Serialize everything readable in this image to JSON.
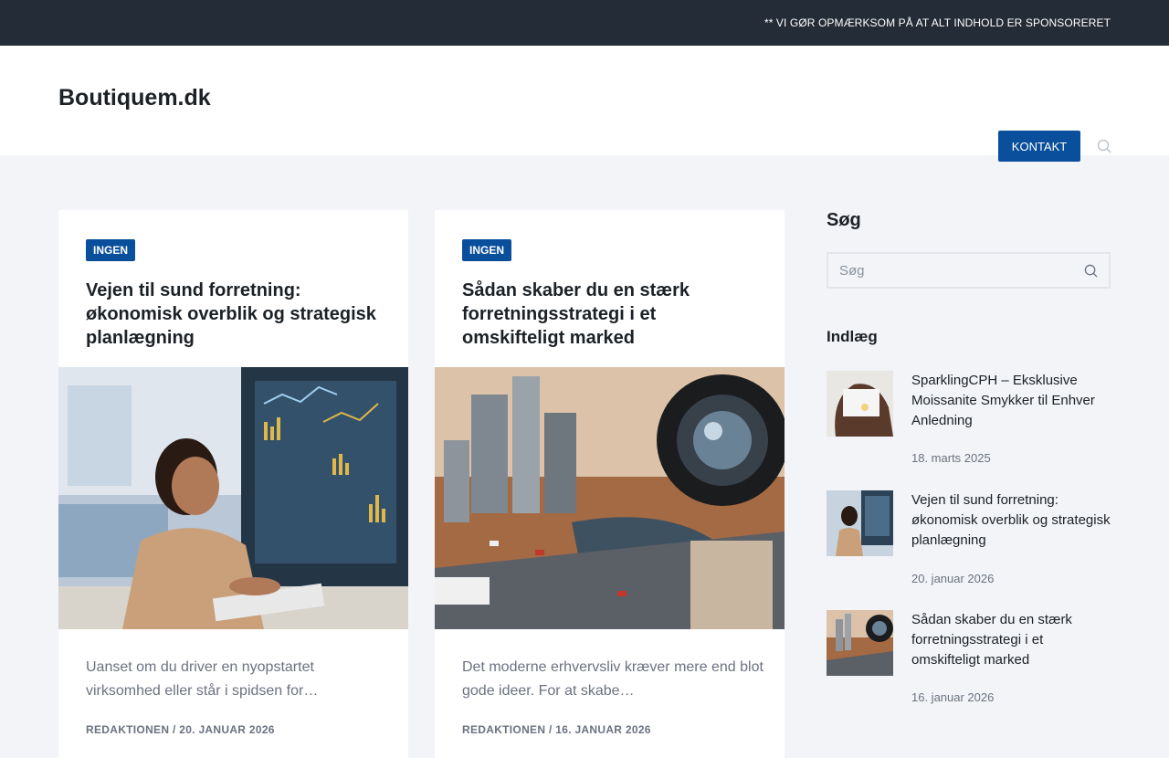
{
  "topbar": {
    "notice": "** VI GØR OPMÆRKSOM PÅ AT ALT INDHOLD ER SPONSORERET"
  },
  "header": {
    "site_title": "Boutiquem.dk",
    "contact_label": "KONTAKT"
  },
  "articles": [
    {
      "category": "INGEN",
      "title": "Vejen til sund forretning: økonomisk overblik og strategisk planlægning",
      "excerpt": "Uanset om du driver en nyopstartet virksomhed eller står i spidsen for…",
      "author": "REDAKTIONEN",
      "date": "20. JANUAR 2026"
    },
    {
      "category": "INGEN",
      "title": "Sådan skaber du en stærk forretningsstrategi i et omskifteligt marked",
      "excerpt": "Det moderne erhvervsliv kræver mere end blot gode ideer. For at skabe…",
      "author": "REDAKTIONEN",
      "date": "16. JANUAR 2026"
    }
  ],
  "sidebar": {
    "search_heading": "Søg",
    "search_placeholder": "Søg",
    "posts_heading": "Indlæg",
    "posts": [
      {
        "title": "SparklingCPH – Eksklusive Moissanite Smykker til Enhver Anledning",
        "date": "18. marts 2025"
      },
      {
        "title": "Vejen til sund forretning: økonomisk overblik og strategisk planlægning",
        "date": "20. januar 2026"
      },
      {
        "title": "Sådan skaber du en stærk forretningsstrategi i et omskifteligt marked",
        "date": "16. januar 2026"
      }
    ]
  },
  "icons": {
    "search": "search-icon"
  },
  "colors": {
    "accent": "#0a4f9c",
    "topbar": "#242c37"
  }
}
